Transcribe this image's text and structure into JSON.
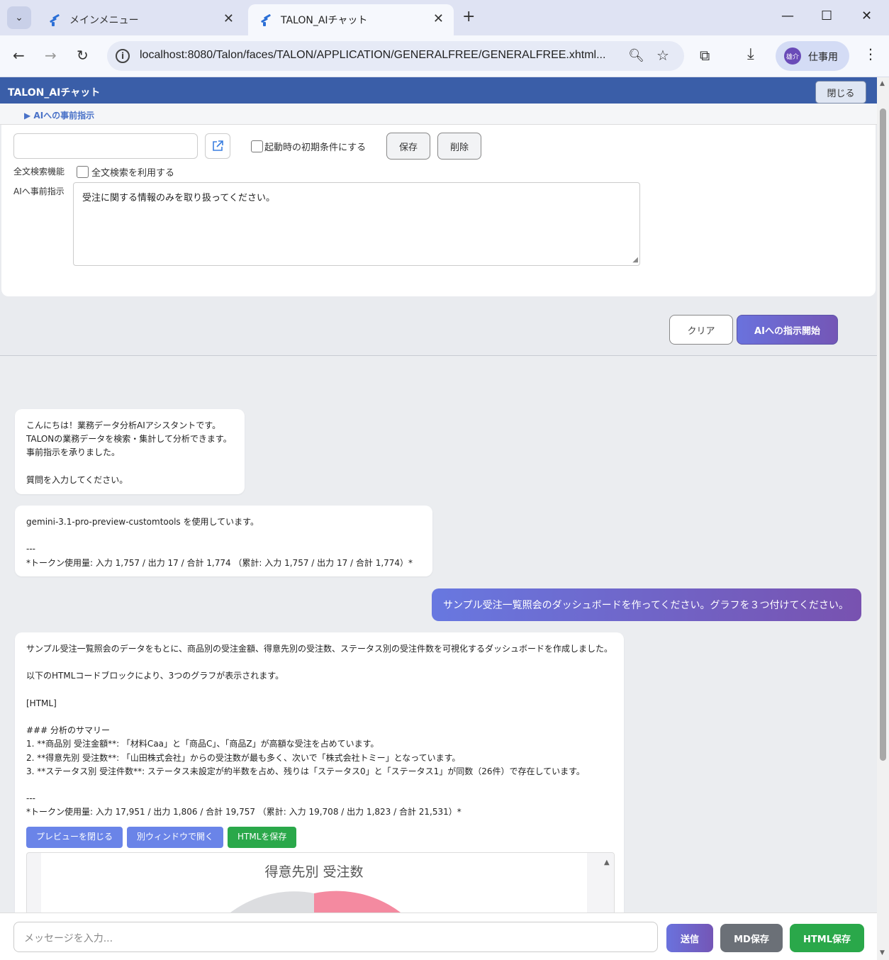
{
  "browser": {
    "tabs": [
      {
        "title": "メインメニュー"
      },
      {
        "title": "TALON_AIチャット"
      }
    ],
    "url": "localhost:8080/Talon/faces/TALON/APPLICATION/GENERALFREE/GENERALFREE.xhtml...",
    "profile": {
      "avatar_text": "雄介",
      "name": "仕事用"
    }
  },
  "app": {
    "title": "TALON_AIチャット",
    "close_label": "閉じる",
    "preinstruction_toggle": "▶ AIへの事前指示",
    "settings": {
      "name_value": "",
      "init_checkbox_label": "起動時の初期条件にする",
      "save_label": "保存",
      "delete_label": "削除",
      "fulltext_label": "全文検索機能",
      "fulltext_checkbox_label": "全文検索を利用する",
      "preinst_label": "AIへ事前指示",
      "preinst_value": "受注に関する情報のみを取り扱ってください。"
    },
    "clear_label": "クリア",
    "start_label": "AIへの指示開始"
  },
  "chat": {
    "msg1": [
      "こんにちは！業務データ分析AIアシスタントです。",
      "TALONの業務データを検索・集計して分析できます。",
      "事前指示を承りました。",
      "",
      "質問を入力してください。"
    ],
    "msg2": [
      "gemini-3.1-pro-preview-customtools を使用しています。",
      "",
      "---",
      "*トークン使用量: 入力 1,757 / 出力 17 / 合計 1,774 （累計: 入力 1,757 / 出力 17 / 合計 1,774）*"
    ],
    "user_msg": "サンプル受注一覧照会のダッシュボードを作ってください。グラフを３つ付けてください。",
    "msg3": [
      "サンプル受注一覧照会のデータをもとに、商品別の受注金額、得意先別の受注数、ステータス別の受注件数を可視化するダッシュボードを作成しました。",
      "",
      "以下のHTMLコードブロックにより、3つのグラフが表示されます。",
      "",
      "[HTML]",
      "",
      "### 分析のサマリー",
      "1. **商品別 受注金額**: 「材料Caa」と「商品C」、「商品Z」が高額な受注を占めています。",
      "2. **得意先別 受注数**: 「山田株式会社」からの受注数が最も多く、次いで「株式会社トミー」となっています。",
      "3. **ステータス別 受注件数**: ステータス未設定が約半数を占め、残りは「ステータス0」と「ステータス1」が同数（26件）で存在しています。",
      "",
      "---",
      "*トークン使用量: 入力 17,951 / 出力 1,806 / 合計 19,757 （累計: 入力 19,708 / 出力 1,823 / 合計 21,531）*"
    ],
    "preview_close_label": "プレビューを閉じる",
    "open_window_label": "別ウィンドウで開く",
    "save_html_label": "HTMLを保存",
    "preview_chart_title": "得意先別 受注数"
  },
  "input": {
    "placeholder": "メッセージを入力...",
    "send_label": "送信",
    "md_save_label": "MD保存",
    "html_save_label": "HTML保存"
  },
  "colors": {
    "header": "#3a5ea8",
    "accent_gradient_start": "#6a72dd",
    "accent_gradient_end": "#7456b6",
    "green": "#2aa84a",
    "gray": "#6b7077"
  }
}
